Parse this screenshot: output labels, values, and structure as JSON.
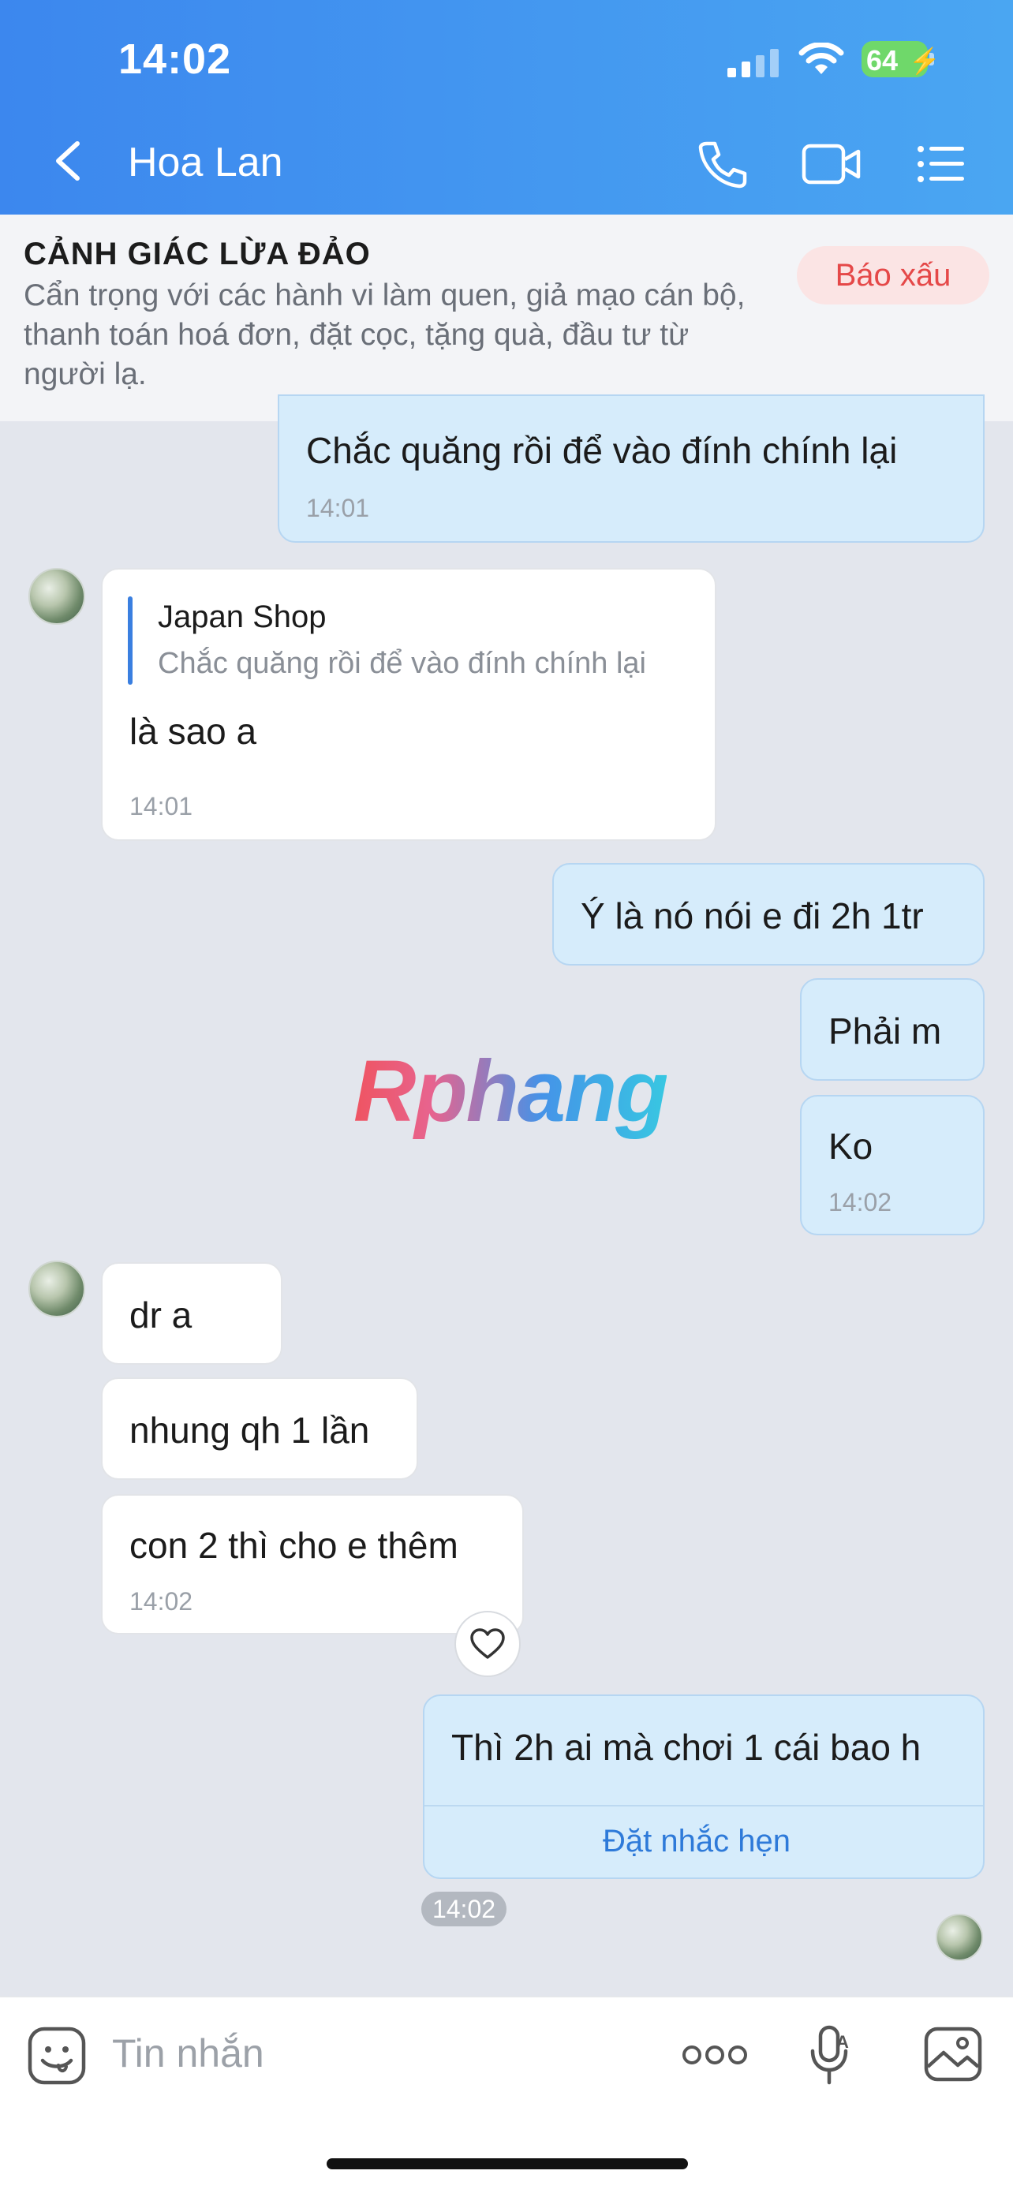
{
  "status": {
    "time": "14:02",
    "battery": "64"
  },
  "header": {
    "title": "Hoa Lan"
  },
  "banner": {
    "title": "CẢNH GIÁC LỪA ĐẢO",
    "text": "Cẩn trọng với các hành vi làm quen, giả mạo cán bộ, thanh toán hoá đơn, đặt cọc, tặng quà, đầu tư từ người lạ.",
    "report_label": "Báo xấu"
  },
  "messages": {
    "m1": {
      "text": "Chắc quăng rồi để vào đính chính lại",
      "time": "14:01"
    },
    "m2": {
      "quote_author": "Japan Shop",
      "quote_text": "Chắc quăng rồi để vào đính chính lại",
      "text": "là sao a",
      "time": "14:01"
    },
    "m3": {
      "text": "Ý là nó nói e đi 2h 1tr"
    },
    "m4": {
      "text": "Phải m"
    },
    "m5": {
      "text": "Ko",
      "time": "14:02"
    },
    "m6": {
      "text": "dr a"
    },
    "m7": {
      "text": "nhung qh 1 lần"
    },
    "m8": {
      "text": "con 2 thì cho e thêm",
      "time": "14:02"
    },
    "m9": {
      "text": "Thì 2h ai mà chơi 1 cái bao h",
      "action": "Đặt nhắc hẹn",
      "time": "14:02"
    }
  },
  "watermark": "Rphang",
  "composer": {
    "placeholder": "Tin nhắn"
  },
  "colors": {
    "header_start": "#3c87ee",
    "header_end": "#4aa6f2",
    "my_bubble": "#d6ecfb",
    "accent": "#2e7ad9",
    "report": "#e54848"
  }
}
